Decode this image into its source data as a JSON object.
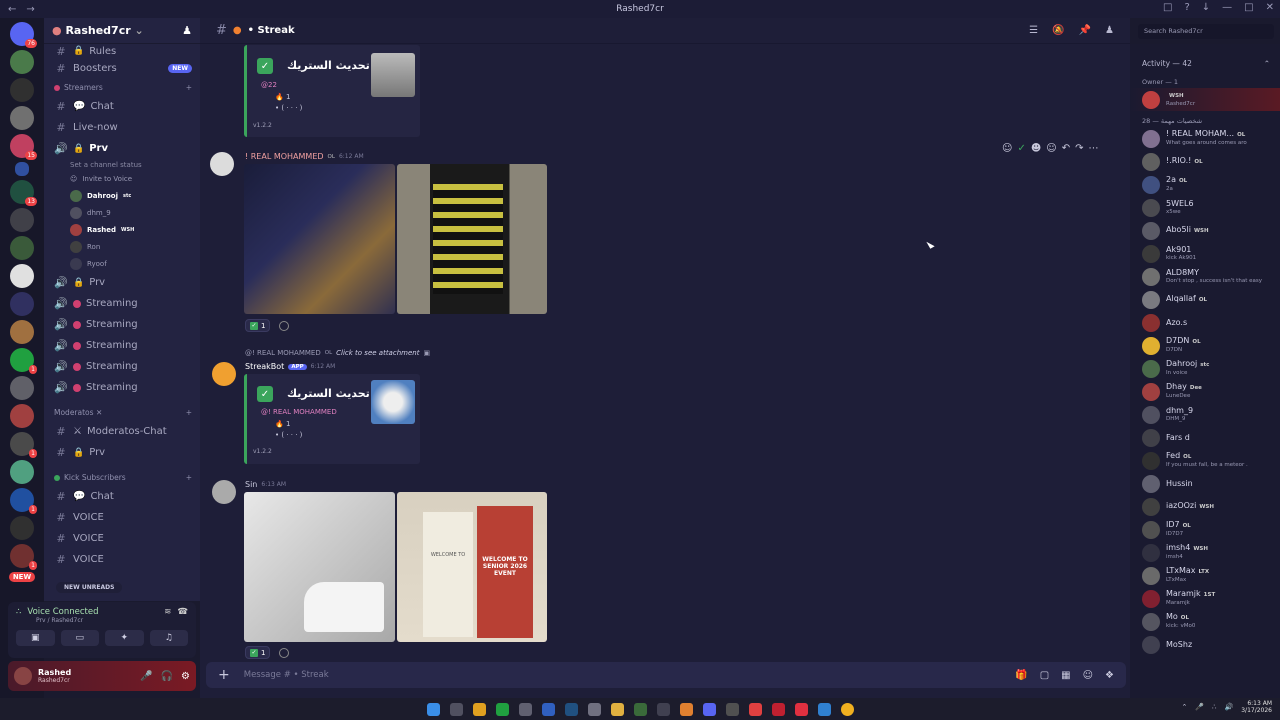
{
  "window": {
    "title": "Rashed7cr"
  },
  "server": {
    "name": "Rashed7cr"
  },
  "channels": {
    "top": [
      {
        "label": "Rules",
        "icon": "lock"
      },
      {
        "label": "Boosters",
        "badge": "NEW"
      }
    ],
    "streamers_cat": "Streamers",
    "streamers": [
      {
        "label": "Chat"
      },
      {
        "label": "Live-now"
      },
      {
        "label": "Prv",
        "active": true
      }
    ],
    "prv_status": "Set a channel status",
    "invite": "Invite to Voice",
    "voice_users": [
      {
        "name": "Dahrooj",
        "tag": "stc"
      },
      {
        "name": "dhm_9",
        "tag": ""
      },
      {
        "name": "Rashed",
        "tag": "WSH"
      },
      {
        "name": "Ron",
        "tag": ""
      },
      {
        "name": "Ryoof",
        "tag": ""
      }
    ],
    "after_voice": [
      {
        "label": "Prv",
        "kind": "lock"
      },
      {
        "label": "Streaming",
        "kind": "dot"
      },
      {
        "label": "Streaming",
        "kind": "dot"
      },
      {
        "label": "Streaming",
        "kind": "dot"
      },
      {
        "label": "Streaming",
        "kind": "dot"
      },
      {
        "label": "Streaming",
        "kind": "dot"
      }
    ],
    "moderators_cat": "Moderatos",
    "moderators": [
      {
        "label": "Moderatos-Chat"
      },
      {
        "label": "Prv",
        "kind": "lock"
      }
    ],
    "kick_cat": "Kick Subscribers",
    "kick": [
      {
        "label": "Chat"
      },
      {
        "label": "VOICE"
      },
      {
        "label": "VOICE"
      },
      {
        "label": "VOICE"
      }
    ],
    "new_unreads": "NEW UNREADS"
  },
  "voice": {
    "status": "Voice Connected",
    "sub": "Prv / Rashed7cr"
  },
  "user": {
    "name": "Rashed",
    "tag": "Rashed7cr"
  },
  "chat": {
    "channel": "Streak",
    "composer_placeholder": "Message # • Streak",
    "msg1_embed": {
      "title": "تم تحديث الستريك •",
      "mention": "@22",
      "count": "1",
      "progress": "• ( · · · )",
      "version": "v1.2.2"
    },
    "msg2": {
      "author": "! REAL MOHAMMED",
      "tag": "OL",
      "time": "6:12 AM",
      "reaction_count": "1"
    },
    "msg3": {
      "reply_to": "@! REAL MOHAMMED",
      "reply_tag": "OL",
      "reply_text": "Click to see attachment",
      "author": "StreakBot",
      "badge": "APP",
      "time": "6:12 AM",
      "embed_title": "تم تحديث الستريك •",
      "mention": "@! REAL MOHAMMED",
      "count": "1",
      "progress": "• ( · · · )",
      "version": "v1.2.2"
    },
    "msg4": {
      "author": "Sin",
      "time": "6:13 AM",
      "reaction_count": "1",
      "banner1": "WELCOME TO",
      "banner2": "WELCOME TO SENIOR 2026 EVENT"
    }
  },
  "search": {
    "placeholder": "Search Rashed7cr"
  },
  "members": {
    "header": "Activity — 42",
    "owner_sec": "Owner — 1",
    "owner": {
      "name": "",
      "tag": "WSH",
      "status": "Rashed7cr",
      "color": "#c04040"
    },
    "sec2": "شخصيات مهمة — 28",
    "list": [
      {
        "name": "! REAL MOHAM...",
        "tag": "OL",
        "status": "What goes around comes aro",
        "color": "#807090"
      },
      {
        "name": "!.RIO.!",
        "tag": "OL",
        "status": "",
        "color": "#606060"
      },
      {
        "name": "2a",
        "tag": "OL",
        "status": "2a",
        "color": "#405080"
      },
      {
        "name": "5WEL6",
        "tag": "",
        "status": "x5we",
        "color": "#4a4a50"
      },
      {
        "name": "Abo5li",
        "tag": "WSH",
        "status": "",
        "color": "#5a5a66"
      },
      {
        "name": "Ak901",
        "tag": "",
        "status": "kick Ak901",
        "color": "#3a3a3a"
      },
      {
        "name": "ALD8MY",
        "tag": "",
        "status": "Don't stop , success isn't that easy",
        "color": "#707070"
      },
      {
        "name": "Alqallaf",
        "tag": "OL",
        "status": "",
        "color": "#7a7a80"
      },
      {
        "name": "Azo.s",
        "tag": "",
        "status": "",
        "color": "#8a3030"
      },
      {
        "name": "D7DN",
        "tag": "OL",
        "status": "D7DN",
        "color": "#e0b030"
      },
      {
        "name": "Dahrooj",
        "tag": "stc",
        "status": "In voice",
        "color": "#4a6a4a"
      },
      {
        "name": "Dhay",
        "tag": "Dee",
        "status": "LuneDee",
        "color": "#a04040"
      },
      {
        "name": "dhm_9",
        "tag": "",
        "status": "DHM_9",
        "color": "#505060"
      },
      {
        "name": "Fars d",
        "tag": "",
        "status": "",
        "color": "#404048"
      },
      {
        "name": "Fed",
        "tag": "OL",
        "status": "If you must fall, be a meteor .",
        "color": "#303030"
      },
      {
        "name": "Hussin",
        "tag": "",
        "status": "",
        "color": "#606070"
      },
      {
        "name": "iazOOzi",
        "tag": "WSH",
        "status": "",
        "color": "#404040"
      },
      {
        "name": "ID7",
        "tag": "OL",
        "status": "ID7D7",
        "color": "#505050"
      },
      {
        "name": "imsh4",
        "tag": "WSH",
        "status": "imsh4",
        "color": "#303040"
      },
      {
        "name": "LTxMax",
        "tag": "LTX",
        "status": "LTxMax",
        "color": "#6a6a6a"
      },
      {
        "name": "Maramjk",
        "tag": "1ST",
        "status": "Maramjk",
        "color": "#802030"
      },
      {
        "name": "Mo",
        "tag": "OL",
        "status": "kick: vMo0",
        "color": "#555560"
      },
      {
        "name": "MoShz",
        "tag": "",
        "status": "",
        "color": "#404050"
      }
    ]
  },
  "taskbar": {
    "time": "6:13 AM",
    "date": "3/17/2026"
  }
}
